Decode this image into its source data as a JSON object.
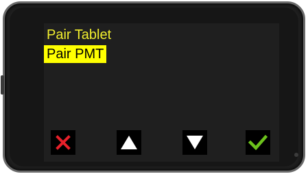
{
  "menu": {
    "items": [
      {
        "label": "Pair Tablet",
        "selected": false
      },
      {
        "label": "Pair PMT",
        "selected": true
      }
    ]
  },
  "buttons": {
    "cancel": {
      "icon": "x-icon",
      "color": "#e8202a"
    },
    "up": {
      "icon": "up-triangle-icon",
      "color": "#ffffff"
    },
    "down": {
      "icon": "down-triangle-icon",
      "color": "#ffffff"
    },
    "confirm": {
      "icon": "checkmark-icon",
      "color": "#6cc21c"
    }
  },
  "colors": {
    "menu_text": "#f2ef2e",
    "selected_background": "#ffff00",
    "selected_text": "#000000",
    "screen_background": "#1f1f1f"
  }
}
